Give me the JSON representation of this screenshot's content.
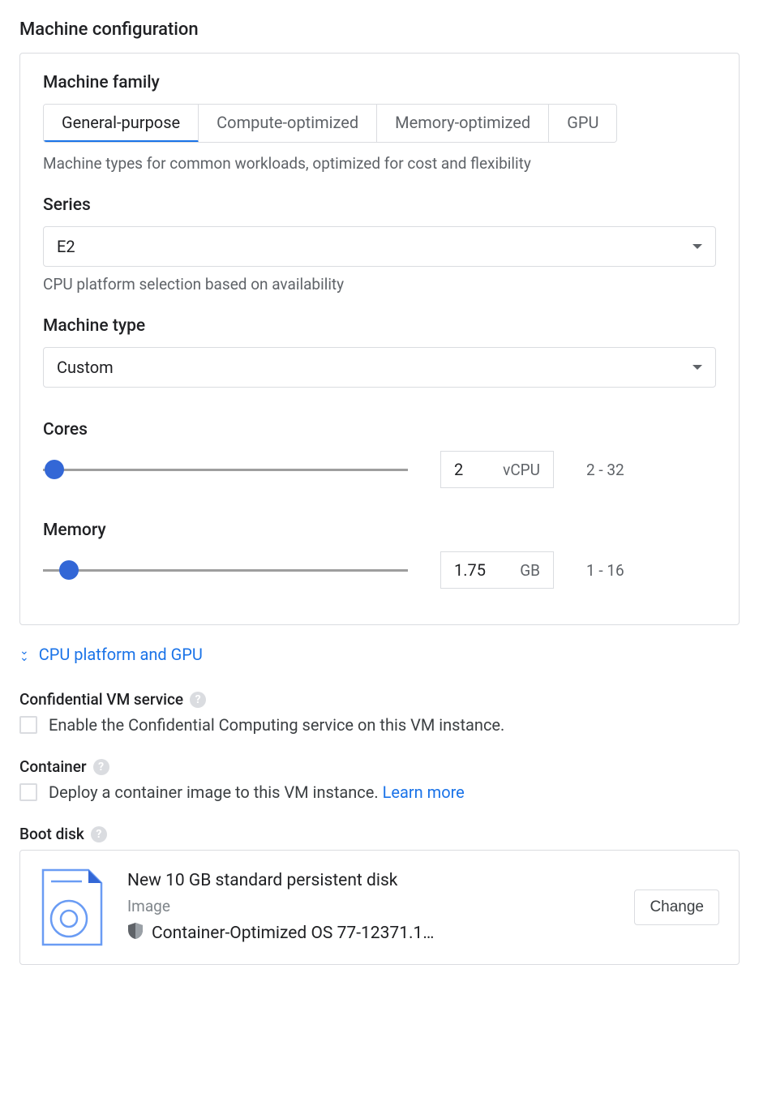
{
  "machine_config": {
    "title": "Machine configuration",
    "family": {
      "label": "Machine family",
      "tabs": [
        "General-purpose",
        "Compute-optimized",
        "Memory-optimized",
        "GPU"
      ],
      "active": 0,
      "description": "Machine types for common workloads, optimized for cost and flexibility"
    },
    "series": {
      "label": "Series",
      "value": "E2",
      "helper": "CPU platform selection based on availability"
    },
    "machine_type": {
      "label": "Machine type",
      "value": "Custom"
    },
    "cores": {
      "label": "Cores",
      "value": "2",
      "unit": "vCPU",
      "range": "2 - 32"
    },
    "memory": {
      "label": "Memory",
      "value": "1.75",
      "unit": "GB",
      "range": "1 - 16"
    }
  },
  "cpu_gpu_expand": "CPU platform and GPU",
  "confidential": {
    "title": "Confidential VM service",
    "checkbox_label": "Enable the Confidential Computing service on this VM instance."
  },
  "container": {
    "title": "Container",
    "checkbox_label": "Deploy a container image to this VM instance. ",
    "learn_more": "Learn more"
  },
  "boot_disk": {
    "title": "Boot disk",
    "disk_title": "New 10 GB standard persistent disk",
    "image_label": "Image",
    "os_name": "Container-Optimized OS 77-12371.1…",
    "change_label": "Change"
  }
}
